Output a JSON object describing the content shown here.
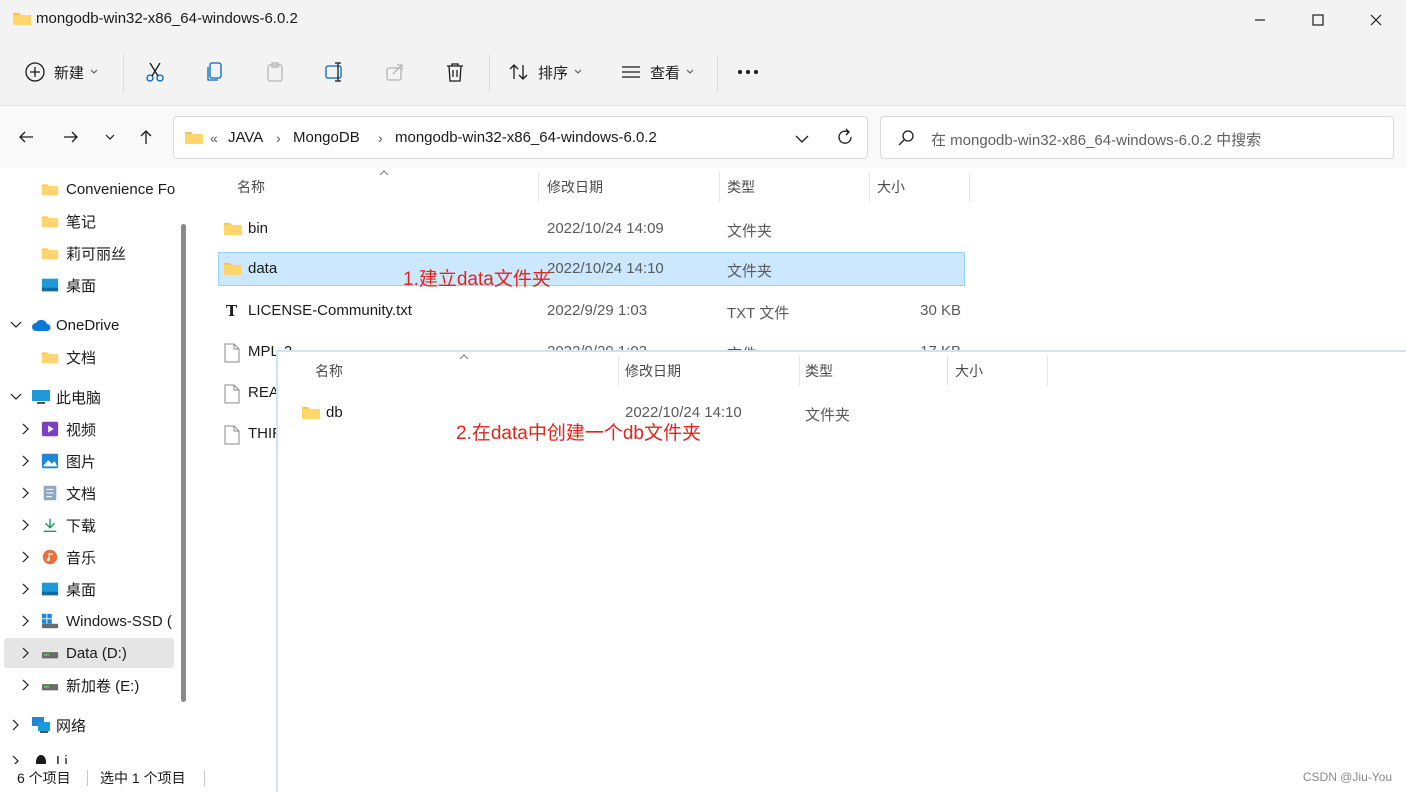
{
  "window": {
    "title": "mongodb-win32-x86_64-windows-6.0.2"
  },
  "toolbar": {
    "new_label": "新建",
    "sort_label": "排序",
    "view_label": "查看"
  },
  "address": {
    "crumbs": [
      "JAVA",
      "MongoDB",
      "mongodb-win32-x86_64-windows-6.0.2"
    ]
  },
  "search": {
    "placeholder": "在 mongodb-win32-x86_64-windows-6.0.2 中搜索"
  },
  "sidebar": {
    "items": [
      {
        "label": "Convenience Fo"
      },
      {
        "label": "笔记"
      },
      {
        "label": "莉可丽丝"
      },
      {
        "label": "桌面"
      },
      {
        "label": "OneDrive"
      },
      {
        "label": "文档"
      },
      {
        "label": "此电脑"
      },
      {
        "label": "视频"
      },
      {
        "label": "图片"
      },
      {
        "label": "文档"
      },
      {
        "label": "下载"
      },
      {
        "label": "音乐"
      },
      {
        "label": "桌面"
      },
      {
        "label": "Windows-SSD ("
      },
      {
        "label": "Data (D:)"
      },
      {
        "label": "新加卷 (E:)"
      },
      {
        "label": "网络"
      },
      {
        "label": "Li"
      }
    ]
  },
  "columns": {
    "name": "名称",
    "date": "修改日期",
    "type": "类型",
    "size": "大小"
  },
  "files": [
    {
      "name": "bin",
      "date": "2022/10/24 14:09",
      "type": "文件夹",
      "size": ""
    },
    {
      "name": "data",
      "date": "2022/10/24 14:10",
      "type": "文件夹",
      "size": ""
    },
    {
      "name": "LICENSE-Community.txt",
      "date": "2022/9/29 1:03",
      "type": "TXT 文件",
      "size": "30 KB"
    },
    {
      "name": "MPL-2",
      "date": "2022/9/29 1:03",
      "type": "文件",
      "size": "17 KB"
    },
    {
      "name": "REA",
      "date": "",
      "type": "",
      "size": ""
    },
    {
      "name": "THIR",
      "date": "",
      "type": "",
      "size": ""
    }
  ],
  "annotations": {
    "step1": "1.建立data文件夹",
    "step2": "2.在data中创建一个db文件夹"
  },
  "overlay": {
    "columns": {
      "name": "名称",
      "date": "修改日期",
      "type": "类型",
      "size": "大小"
    },
    "files": [
      {
        "name": "db",
        "date": "2022/10/24 14:10",
        "type": "文件夹"
      }
    ]
  },
  "status": {
    "count": "6 个项目",
    "selected": "选中 1 个项目"
  },
  "watermark": "CSDN @Jiu-You",
  "colors": {
    "accent": "#0067c0",
    "folder": "#f8c44f",
    "selection": "#cce8ff",
    "annotation": "#e1251b"
  }
}
